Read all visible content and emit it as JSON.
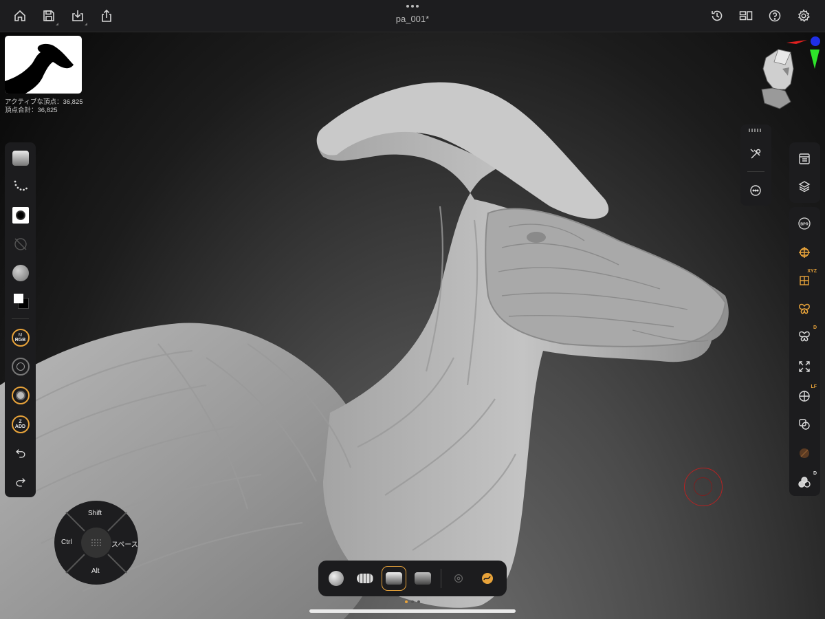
{
  "topbar": {
    "title": "pa_001*",
    "left_buttons": [
      "home-icon",
      "save-icon",
      "import-icon",
      "share-icon"
    ],
    "right_buttons": [
      "history-icon",
      "layout-icon",
      "help-icon",
      "settings-icon"
    ]
  },
  "stats": {
    "active_vertices": "アクティブな頂点：36,825",
    "total_vertices": "頂点合計：36,825"
  },
  "left_toolbar": {
    "items": [
      "brush-preview",
      "stroke-icon",
      "alpha-icon",
      "texture-icon",
      "material-icon",
      "color-icon"
    ],
    "rgb_mode_top": "M",
    "rgb_mode": "RGB",
    "z_mode_top": "Z",
    "z_mode": "ADD"
  },
  "right_panel": {
    "badges": {
      "xyz": "XYZ",
      "symmetry_d": "D",
      "lf": "LF",
      "dyn": "D"
    }
  },
  "modifier_pad": {
    "shift": "Shift",
    "ctrl": "Ctrl",
    "space": "スペース",
    "alt": "Alt"
  },
  "colors": {
    "accent": "#e8a33a",
    "gizmo_red": "#e0201f",
    "gizmo_green": "#2ee32a",
    "gizmo_blue": "#1f2fe6"
  }
}
